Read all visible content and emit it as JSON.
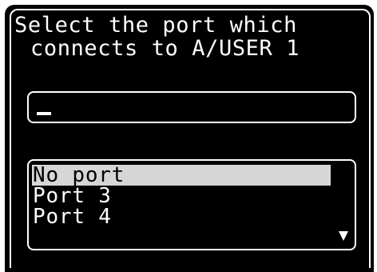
{
  "prompt": {
    "line1": "Select the port which",
    "line2": "connects to A/USER 1"
  },
  "input": {
    "value": "_"
  },
  "port_list": {
    "items": [
      {
        "label": "No port",
        "selected": true
      },
      {
        "label": "Port 3",
        "selected": false
      },
      {
        "label": "Port 4",
        "selected": false
      }
    ]
  },
  "icons": {
    "scroll": "scroll-down-arrow-icon"
  },
  "colors": {
    "background": "#000000",
    "foreground": "#ffffff",
    "highlight": "#d6d6d6"
  }
}
